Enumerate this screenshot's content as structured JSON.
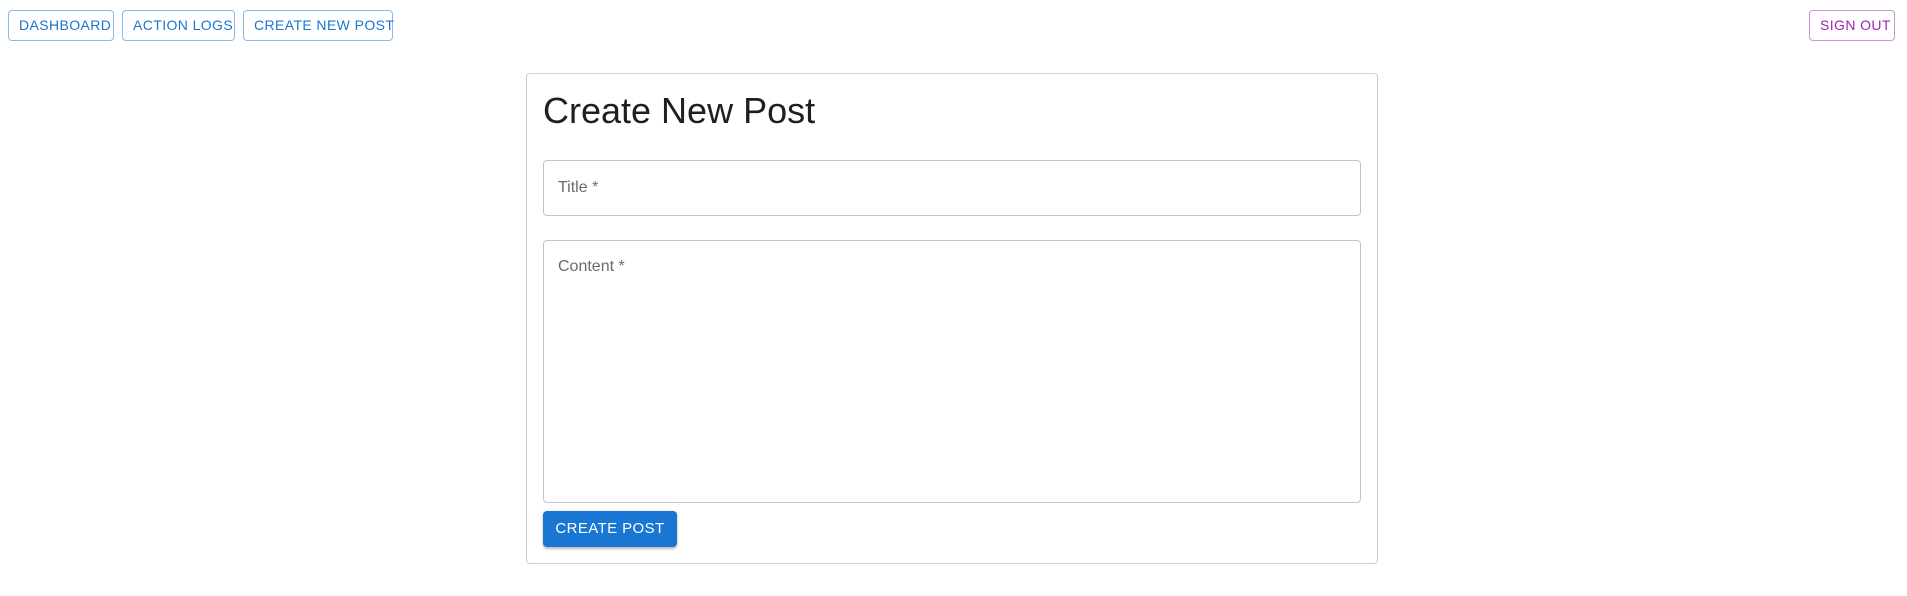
{
  "nav": {
    "dashboard_label": "DASHBOARD",
    "action_logs_label": "ACTION LOGS",
    "create_new_post_label": "CREATE NEW POST",
    "sign_out_label": "SIGN OUT"
  },
  "form": {
    "heading": "Create New Post",
    "title_field": {
      "label": "Title *",
      "value": ""
    },
    "content_field": {
      "label": "Content *",
      "value": ""
    },
    "submit_label": "CREATE POST"
  },
  "colors": {
    "primary": "#1976d2",
    "secondary": "#9c27b0"
  }
}
